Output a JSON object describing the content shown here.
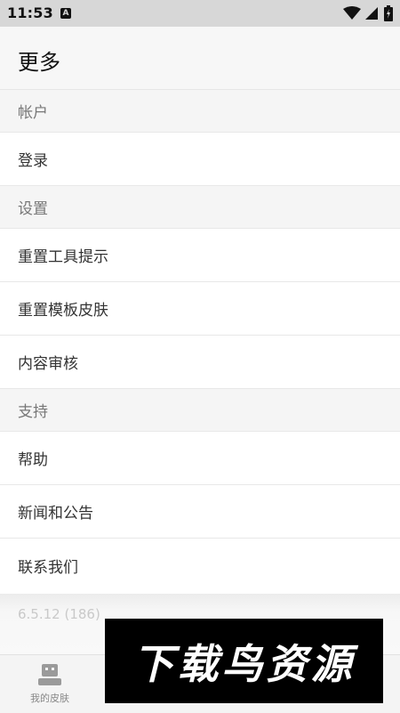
{
  "status_bar": {
    "time": "11:53",
    "notification_glyph": "A",
    "icons": [
      "notification-icon",
      "wifi-icon",
      "signal-icon",
      "battery-icon"
    ]
  },
  "header": {
    "title": "更多"
  },
  "sections": {
    "account": {
      "header": "帐户",
      "items": [
        "登录"
      ]
    },
    "settings": {
      "header": "设置",
      "items": [
        "重置工具提示",
        "重置模板皮肤",
        "内容审核"
      ]
    },
    "support": {
      "header": "支持",
      "items": [
        "帮助",
        "新闻和公告",
        "联系我们"
      ]
    }
  },
  "footer": {
    "version": "6.5.12 (186)"
  },
  "bottom_nav": {
    "tabs": [
      {
        "label": "我的皮肤",
        "icon": "robot-icon"
      }
    ]
  },
  "watermark": {
    "text": "下载鸟资源"
  }
}
